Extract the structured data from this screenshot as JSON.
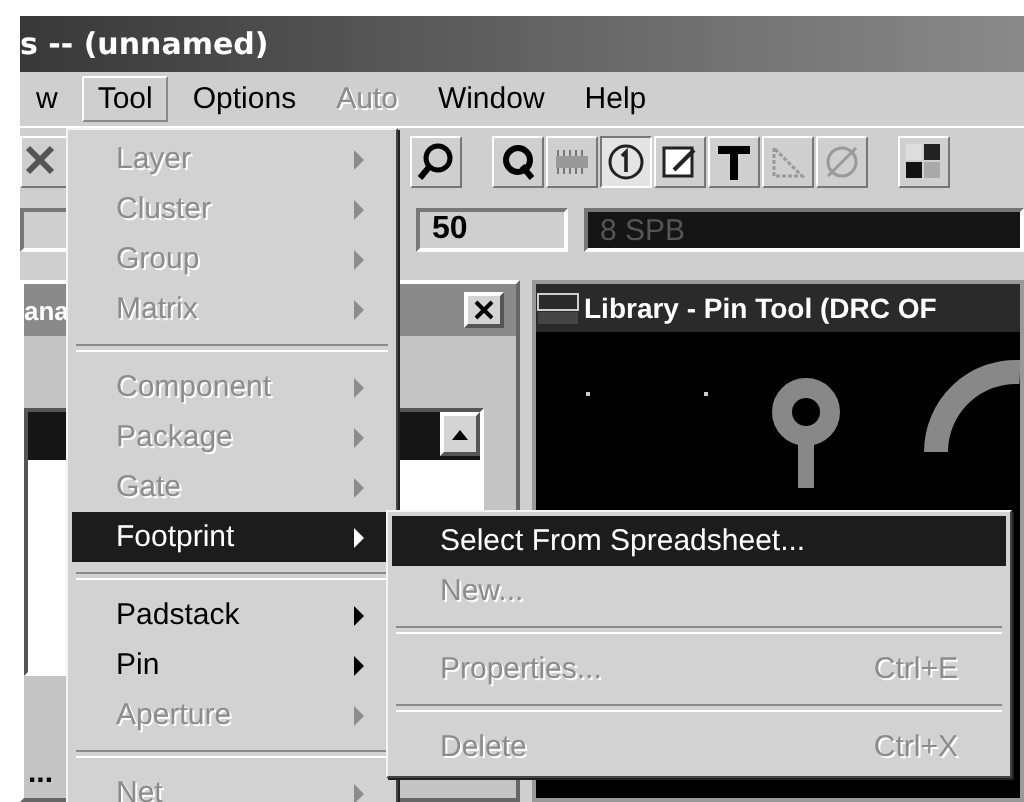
{
  "window": {
    "title": "s -- (unnamed)"
  },
  "menu_bar": [
    {
      "label": "w",
      "selected": false,
      "disabled": false
    },
    {
      "label": "Tool",
      "selected": true,
      "disabled": false
    },
    {
      "label": "Options",
      "selected": false,
      "disabled": false
    },
    {
      "label": "Auto",
      "selected": false,
      "disabled": true
    },
    {
      "label": "Window",
      "selected": false,
      "disabled": false
    },
    {
      "label": "Help",
      "selected": false,
      "disabled": false
    }
  ],
  "settings_bar": {
    "grid_value": "50",
    "layer_value": "8  SPB"
  },
  "left_panel": {
    "title": "ana",
    "footer": "..."
  },
  "library_window": {
    "title": "Library - Pin Tool (DRC OF"
  },
  "tool_menu": {
    "items": [
      {
        "kind": "item",
        "label": "Layer",
        "disabled": true,
        "selected": false,
        "submenu": true
      },
      {
        "kind": "item",
        "label": "Cluster",
        "disabled": true,
        "selected": false,
        "submenu": true
      },
      {
        "kind": "item",
        "label": "Group",
        "disabled": true,
        "selected": false,
        "submenu": true
      },
      {
        "kind": "item",
        "label": "Matrix",
        "disabled": true,
        "selected": false,
        "submenu": true
      },
      {
        "kind": "separator"
      },
      {
        "kind": "item",
        "label": "Component",
        "disabled": true,
        "selected": false,
        "submenu": true
      },
      {
        "kind": "item",
        "label": "Package",
        "disabled": true,
        "selected": false,
        "submenu": true
      },
      {
        "kind": "item",
        "label": "Gate",
        "disabled": true,
        "selected": false,
        "submenu": true
      },
      {
        "kind": "item",
        "label": "Footprint",
        "disabled": false,
        "selected": true,
        "submenu": true
      },
      {
        "kind": "separator"
      },
      {
        "kind": "item",
        "label": "Padstack",
        "disabled": false,
        "selected": false,
        "submenu": true
      },
      {
        "kind": "item",
        "label": "Pin",
        "disabled": false,
        "selected": false,
        "submenu": true
      },
      {
        "kind": "item",
        "label": "Aperture",
        "disabled": true,
        "selected": false,
        "submenu": true
      },
      {
        "kind": "separator"
      },
      {
        "kind": "item",
        "label": "Net",
        "disabled": true,
        "selected": false,
        "submenu": true
      }
    ]
  },
  "footprint_submenu": {
    "items": [
      {
        "kind": "item",
        "label": "Select From Spreadsheet...",
        "disabled": false,
        "selected": true
      },
      {
        "kind": "item",
        "label": "New...",
        "disabled": true,
        "selected": false
      },
      {
        "kind": "separator"
      },
      {
        "kind": "item",
        "label": "Properties...",
        "shortcut": "Ctrl+E",
        "disabled": true,
        "selected": false
      },
      {
        "kind": "separator"
      },
      {
        "kind": "item",
        "label": "Delete",
        "shortcut": "Ctrl+X",
        "disabled": true,
        "selected": false
      }
    ]
  }
}
